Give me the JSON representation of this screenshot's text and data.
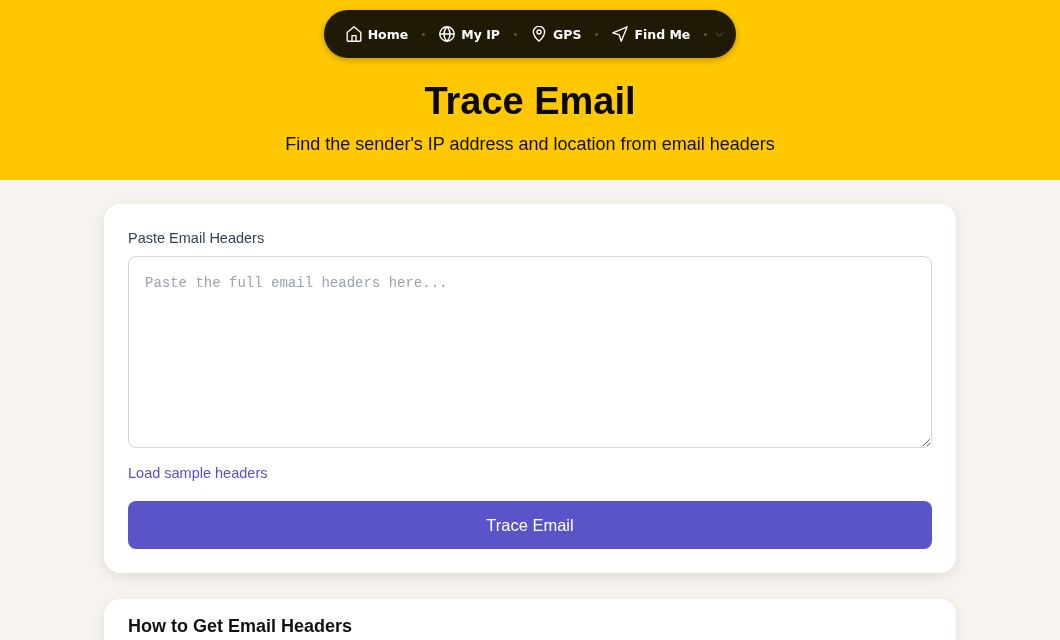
{
  "nav": {
    "items": [
      {
        "label": "Home"
      },
      {
        "label": "My IP"
      },
      {
        "label": "GPS"
      },
      {
        "label": "Find Me"
      }
    ]
  },
  "hero": {
    "title": "Trace Email",
    "subtitle": "Find the sender's IP address and location from email headers"
  },
  "form": {
    "label": "Paste Email Headers",
    "headers_field": {
      "placeholder": "Paste the full email headers here..."
    },
    "sample_link": "Load sample headers",
    "submit_button": "Trace Email"
  },
  "guide": {
    "title": "How to Get Email Headers"
  }
}
